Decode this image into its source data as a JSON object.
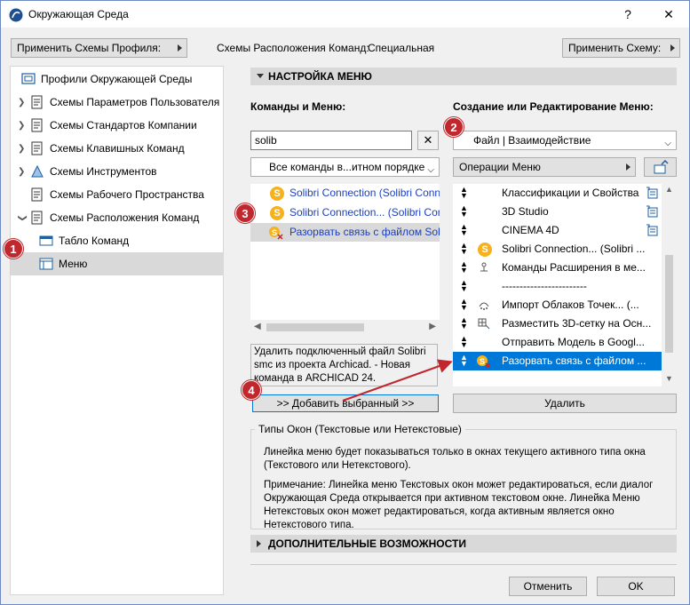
{
  "window": {
    "title": "Окружающая Среда",
    "help_label": "?",
    "close_label": "✕"
  },
  "top": {
    "apply_profile_label": "Применить Схемы Профиля:",
    "schemes_label": "Схемы Расположения Команд:",
    "schemes_value": "Специальная",
    "apply_scheme_label": "Применить Схему:"
  },
  "tree": [
    {
      "label": "Профили Окружающей Среды",
      "icon": "profiles-icon"
    },
    {
      "label": "Схемы Параметров Пользователя",
      "icon": "scheme-icon"
    },
    {
      "label": "Схемы Стандартов Компании",
      "icon": "scheme-icon"
    },
    {
      "label": "Схемы Клавишных Команд",
      "icon": "scheme-icon"
    },
    {
      "label": "Схемы Инструментов",
      "icon": "scheme-icon"
    },
    {
      "label": "Схемы Рабочего Пространства",
      "icon": "scheme-icon"
    },
    {
      "label": "Схемы Расположения Команд",
      "icon": "scheme-icon"
    },
    {
      "label": "Табло Команд",
      "icon": "toolbar-icon"
    },
    {
      "label": "Меню",
      "icon": "menu-icon"
    }
  ],
  "section": {
    "menu_settings": "НАСТРОЙКА МЕНЮ",
    "advanced": "ДОПОЛНИТЕЛЬНЫЕ ВОЗМОЖНОСТИ"
  },
  "commands": {
    "title": "Команды и Меню:",
    "search_value": "solib",
    "filter_value": "Все команды в...итном порядке",
    "items": [
      "Solibri Connection (Solibri Conne",
      "Solibri Connection... (Solibri Con",
      "Разорвать связь с файлом Solibi"
    ],
    "description": "Удалить подключенный файл Solibri smc из проекта Archicad. - Новая команда в ARCHICAD 24.",
    "add_button": ">> Добавить выбранный >>"
  },
  "menu_edit": {
    "title": "Создание или Редактирование Меню:",
    "menu_value": "Файл | Взаимодействие",
    "ops_label": "Операции Меню",
    "items": [
      "Классификации и Свойства",
      "3D Studio",
      "CINEMA 4D",
      "Solibri Connection... (Solibri ...",
      "Команды Расширения в ме...",
      "------------------------",
      "Импорт Облаков Точек... (...",
      "Разместить 3D-сетку на Осн...",
      "Отправить Модель в Googl...",
      "Разорвать связь с файлом ..."
    ],
    "delete_button": "Удалить"
  },
  "window_types": {
    "title": "Типы Окон (Текстовые или Нетекстовые)",
    "para1": "Линейка меню будет показываться только в окнах текущего активного типа окна (Текстового или Нетекстового).",
    "para2": "Примечание: Линейка меню Текстовых окон может редактироваться, если диалог Окружающая Среда открывается при активном текстовом окне. Линейка Меню Нетекстовых окон может редактироваться, когда активным является окно Нетекстового типа."
  },
  "buttons": {
    "cancel": "Отменить",
    "ok": "OK"
  },
  "badges": [
    "1",
    "2",
    "3",
    "4"
  ],
  "colors": {
    "selection_blue": "#0078d7",
    "badge_red": "#c0282e",
    "solibri_yellow": "#f5b21d"
  }
}
